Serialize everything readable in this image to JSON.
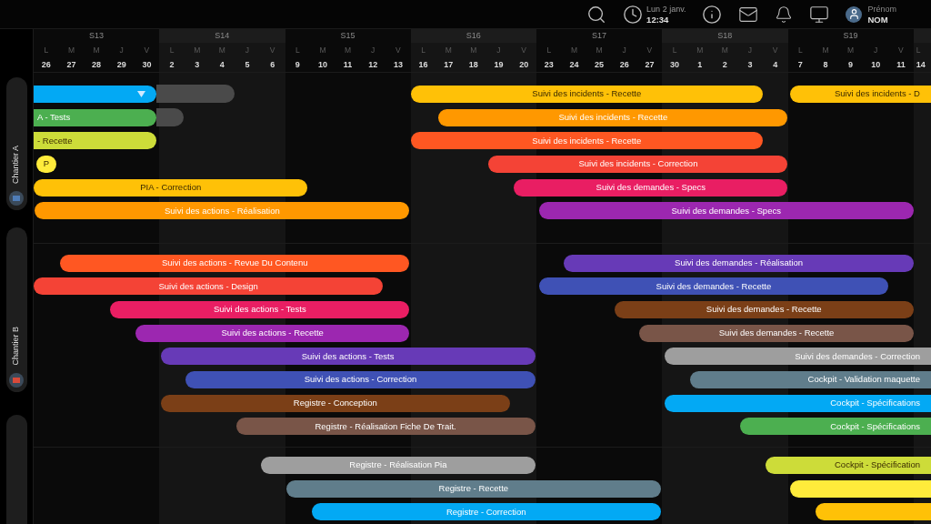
{
  "topbar": {
    "date": "Lun 2 janv.",
    "time": "12:34",
    "user": {
      "first_name": "Prénom",
      "last_name": "NOM"
    }
  },
  "weeks": [
    {
      "label": "S13",
      "days": [
        {
          "letter": "L",
          "date": "26"
        },
        {
          "letter": "M",
          "date": "27"
        },
        {
          "letter": "M",
          "date": "28"
        },
        {
          "letter": "J",
          "date": "29"
        },
        {
          "letter": "V",
          "date": "30"
        }
      ]
    },
    {
      "label": "S14",
      "days": [
        {
          "letter": "L",
          "date": "2"
        },
        {
          "letter": "M",
          "date": "3"
        },
        {
          "letter": "M",
          "date": "4"
        },
        {
          "letter": "J",
          "date": "5"
        },
        {
          "letter": "V",
          "date": "6"
        }
      ]
    },
    {
      "label": "S15",
      "days": [
        {
          "letter": "L",
          "date": "9"
        },
        {
          "letter": "M",
          "date": "10"
        },
        {
          "letter": "M",
          "date": "11"
        },
        {
          "letter": "J",
          "date": "12"
        },
        {
          "letter": "V",
          "date": "13"
        }
      ]
    },
    {
      "label": "S16",
      "days": [
        {
          "letter": "L",
          "date": "16"
        },
        {
          "letter": "M",
          "date": "17"
        },
        {
          "letter": "M",
          "date": "18"
        },
        {
          "letter": "J",
          "date": "19"
        },
        {
          "letter": "V",
          "date": "20"
        }
      ]
    },
    {
      "label": "S17",
      "days": [
        {
          "letter": "L",
          "date": "23"
        },
        {
          "letter": "M",
          "date": "24"
        },
        {
          "letter": "M",
          "date": "25"
        },
        {
          "letter": "J",
          "date": "26"
        },
        {
          "letter": "V",
          "date": "27"
        }
      ]
    },
    {
      "label": "S18",
      "days": [
        {
          "letter": "L",
          "date": "30"
        },
        {
          "letter": "M",
          "date": "1"
        },
        {
          "letter": "M",
          "date": "2"
        },
        {
          "letter": "J",
          "date": "3"
        },
        {
          "letter": "V",
          "date": "4"
        }
      ]
    },
    {
      "label": "S19",
      "days": [
        {
          "letter": "L",
          "date": "7"
        },
        {
          "letter": "M",
          "date": "8"
        },
        {
          "letter": "M",
          "date": "9"
        },
        {
          "letter": "J",
          "date": "10"
        },
        {
          "letter": "V",
          "date": "11"
        }
      ]
    },
    {
      "days": [
        {
          "letter": "L",
          "date": "14"
        }
      ]
    }
  ],
  "sections": [
    {
      "label": "Chantier A",
      "color": "#4f7db8",
      "rows": [
        {
          "bars": [
            {
              "color": "#03a9f4",
              "cut_left": true,
              "menu": true,
              "track": true
            },
            {
              "label": "Suivi des incidents - Recette",
              "color": "#ffc107",
              "dark_text": true
            },
            {
              "label": "Suivi des incidents - D",
              "color": "#ffc107",
              "dark_text": true,
              "cut_right": true
            }
          ]
        },
        {
          "bars": [
            {
              "label": "A - Tests",
              "color": "#4caf50",
              "cut_left": true,
              "track": true
            },
            {
              "label": "Suivi des incidents - Recette",
              "color": "#ff9800"
            }
          ]
        },
        {
          "bars": [
            {
              "label": "- Recette",
              "color": "#cddc39",
              "dark_text": true,
              "cut_left": true
            },
            {
              "label": "Suivi des incidents - Recette",
              "color": "#ff5722"
            }
          ]
        },
        {
          "bars": [
            {
              "label": "P",
              "color": "#ffeb3b",
              "dark_text": true
            },
            {
              "label": "Suivi des incidents - Correction",
              "color": "#f44336"
            }
          ]
        },
        {
          "bars": [
            {
              "label": "PIA - Correction",
              "color": "#ffc107",
              "dark_text": true
            },
            {
              "label": "Suivi des demandes - Specs",
              "color": "#e91e63"
            }
          ]
        },
        {
          "bars": [
            {
              "label": "Suivi des actions - Réalisation",
              "color": "#ff9800"
            },
            {
              "label": "Suivi des demandes - Specs",
              "color": "#9c27b0"
            }
          ]
        }
      ]
    },
    {
      "label": "Chantier B",
      "color": "#d84a3a",
      "rows": [
        {
          "bars": [
            {
              "label": "Suivi des actions - Revue Du Contenu",
              "color": "#ff5722"
            },
            {
              "label": "Suivi des demandes - Réalisation",
              "color": "#673ab7"
            }
          ]
        },
        {
          "bars": [
            {
              "label": "Suivi des actions - Design",
              "color": "#f44336"
            },
            {
              "label": "Suivi des demandes - Recette",
              "color": "#3f51b5"
            }
          ]
        },
        {
          "bars": [
            {
              "label": "Suivi des actions - Tests",
              "color": "#e91e63"
            },
            {
              "label": "Suivi des demandes - Recette",
              "color": "#7b3f17"
            }
          ]
        },
        {
          "bars": [
            {
              "label": "Suivi des actions - Recette",
              "color": "#9c27b0"
            },
            {
              "label": "Suivi des demandes - Recette",
              "color": "#795548"
            }
          ]
        },
        {
          "bars": [
            {
              "label": "Suivi des actions - Tests",
              "color": "#673ab7"
            },
            {
              "label": "Suivi des demandes - Correction",
              "color": "#9e9e9e",
              "cut_right": true
            }
          ]
        },
        {
          "bars": [
            {
              "label": "Suivi des actions - Correction",
              "color": "#3f51b5"
            },
            {
              "label": "Cockpit - Validation maquette",
              "color": "#607d8b",
              "cut_right": true
            }
          ]
        },
        {
          "bars": [
            {
              "label": "Registre - Conception",
              "color": "#7b3f17"
            },
            {
              "label": "Cockpit - Spécifications",
              "color": "#03a9f4",
              "cut_right": true
            }
          ]
        },
        {
          "bars": [
            {
              "label": "Registre - Réalisation Fiche De Trait.",
              "color": "#795548"
            },
            {
              "label": "Cockpit - Spécifications",
              "color": "#4caf50",
              "cut_right": true
            }
          ]
        }
      ]
    },
    {
      "rows": [
        {
          "bars": [
            {
              "label": "Registre - Réalisation Pia",
              "color": "#9e9e9e"
            },
            {
              "label": "Cockpit - Spécification",
              "color": "#cddc39",
              "dark_text": true,
              "cut_right": true
            }
          ]
        },
        {
          "bars": [
            {
              "label": "Registre - Recette",
              "color": "#607d8b"
            },
            {
              "color": "#ffeb3b",
              "cut_right": true
            }
          ]
        },
        {
          "bars": [
            {
              "label": "Registre - Correction",
              "color": "#03a9f4"
            },
            {
              "color": "#ffc107",
              "cut_right": true
            }
          ]
        }
      ]
    }
  ]
}
